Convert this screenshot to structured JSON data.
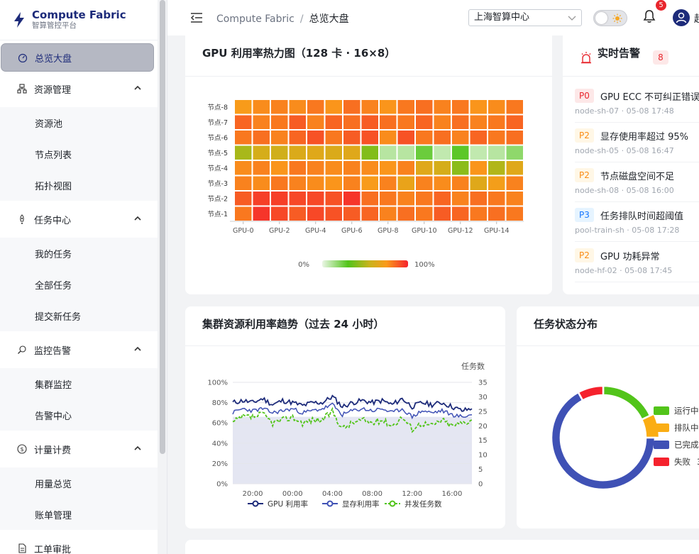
{
  "brand": {
    "name": "Compute Fabric",
    "subtitle": "智算管控平台"
  },
  "sidebar": {
    "active": "总览大盘",
    "groups": [
      {
        "label": "资源管理",
        "items": [
          "资源池",
          "节点列表",
          "拓扑视图"
        ]
      },
      {
        "label": "任务中心",
        "items": [
          "我的任务",
          "全部任务",
          "提交新任务"
        ]
      },
      {
        "label": "监控告警",
        "items": [
          "集群监控",
          "告警中心"
        ]
      },
      {
        "label": "计量计费",
        "items": [
          "用量总览",
          "账单管理"
        ]
      },
      {
        "label": "工单审批",
        "items": []
      }
    ]
  },
  "header": {
    "breadcrumb_root": "Compute Fabric",
    "breadcrumb_sep": "/",
    "breadcrumb_current": "总览大盘",
    "region": "上海智算中心",
    "notification_count": "5",
    "user_name": "赵"
  },
  "heatmap": {
    "title": "GPU 利用率热力图（128 卡 · 16×8）",
    "row_labels": [
      "节点-8",
      "节点-7",
      "节点-6",
      "节点-5",
      "节点-4",
      "节点-3",
      "节点-2",
      "节点-1"
    ],
    "col_tick_labels": [
      "GPU-0",
      "GPU-2",
      "GPU-4",
      "GPU-6",
      "GPU-8",
      "GPU-10",
      "GPU-12",
      "GPU-14"
    ],
    "legend_min": "0%",
    "legend_max": "100%",
    "values": [
      [
        74,
        78,
        80,
        78,
        82,
        76,
        84,
        80,
        76,
        82,
        84,
        80,
        82,
        76,
        78,
        82
      ],
      [
        86,
        80,
        82,
        88,
        80,
        86,
        84,
        88,
        84,
        82,
        86,
        80,
        84,
        80,
        82,
        86
      ],
      [
        82,
        84,
        80,
        86,
        90,
        82,
        88,
        90,
        78,
        90,
        82,
        84,
        80,
        86,
        82,
        84
      ],
      [
        48,
        60,
        58,
        62,
        64,
        62,
        64,
        40,
        10,
        10,
        25,
        8,
        28,
        8,
        10,
        18
      ],
      [
        78,
        80,
        76,
        82,
        80,
        78,
        80,
        78,
        76,
        80,
        64,
        60,
        42,
        76,
        50,
        64
      ],
      [
        80,
        78,
        82,
        80,
        78,
        76,
        80,
        74,
        80,
        68,
        80,
        78,
        80,
        64,
        72,
        80
      ],
      [
        88,
        94,
        94,
        92,
        92,
        90,
        96,
        84,
        82,
        80,
        82,
        86,
        80,
        84,
        82,
        80
      ],
      [
        82,
        96,
        92,
        88,
        92,
        90,
        88,
        86,
        80,
        84,
        82,
        88,
        86,
        82,
        84,
        82
      ]
    ]
  },
  "alarms": {
    "title": "实时告警",
    "count": "8",
    "items": [
      {
        "level": "P0",
        "text": "GPU ECC 不可纠正错误",
        "meta": "node-sh-07 · 05-08 17:48"
      },
      {
        "level": "P2",
        "text": "显存使用率超过 95%",
        "meta": "node-sh-05 · 05-08 16:47"
      },
      {
        "level": "P2",
        "text": "节点磁盘空间不足",
        "meta": "node-sh-08 · 05-08 16:00"
      },
      {
        "level": "P3",
        "text": "任务排队时间超阈值",
        "meta": "pool-train-sh · 05-08 17:28"
      },
      {
        "level": "P2",
        "text": "GPU 功耗异常",
        "meta": "node-hf-02 · 05-08 17:45"
      }
    ]
  },
  "trend": {
    "title": "集群资源利用率趋势（过去 24 小时）",
    "y_right_label": "任务数",
    "y_left_ticks": [
      "0%",
      "20%",
      "40%",
      "60%",
      "80%",
      "100%"
    ],
    "y_right_ticks": [
      "0",
      "5",
      "10",
      "15",
      "20",
      "25",
      "30",
      "35"
    ],
    "x_ticks": [
      "20:00",
      "00:00",
      "04:00",
      "08:00",
      "12:00",
      "16:00"
    ],
    "legend": [
      "GPU 利用率",
      "显存利用率",
      "并发任务数"
    ]
  },
  "status": {
    "title": "任务状态分布",
    "legend": [
      "运行中",
      "排队中",
      "已完成",
      "失败"
    ],
    "legend_suffix": [
      "",
      "",
      "",
      "3"
    ]
  },
  "colors": {
    "brand": "#1d2b7a",
    "gpu_line": "#1d2b7a",
    "mem_line": "#3f51b5",
    "task_line": "#52c41a",
    "running": "#52c41a",
    "queued": "#faad14",
    "completed": "#3f51b5",
    "failed": "#f5222d"
  },
  "chart_data": [
    {
      "type": "heatmap",
      "title": "GPU 利用率热力图（128 卡 · 16×8）",
      "rows": [
        "节点-8",
        "节点-7",
        "节点-6",
        "节点-5",
        "节点-4",
        "节点-3",
        "节点-2",
        "节点-1"
      ],
      "columns": [
        "GPU-0",
        "GPU-1",
        "GPU-2",
        "GPU-3",
        "GPU-4",
        "GPU-5",
        "GPU-6",
        "GPU-7",
        "GPU-8",
        "GPU-9",
        "GPU-10",
        "GPU-11",
        "GPU-12",
        "GPU-13",
        "GPU-14",
        "GPU-15"
      ],
      "range": [
        0,
        100
      ]
    },
    {
      "type": "line",
      "title": "集群资源利用率趋势（过去 24 小时）",
      "x": [
        "18:00",
        "19:00",
        "20:00",
        "21:00",
        "22:00",
        "23:00",
        "00:00",
        "01:00",
        "02:00",
        "03:00",
        "04:00",
        "05:00",
        "06:00",
        "07:00",
        "08:00",
        "09:00",
        "10:00",
        "11:00",
        "12:00",
        "13:00",
        "14:00",
        "15:00",
        "16:00",
        "17:00",
        "18:00"
      ],
      "series": [
        {
          "name": "GPU 利用率",
          "axis": "left",
          "values": [
            80,
            82,
            80,
            84,
            78,
            82,
            80,
            77,
            80,
            80,
            86,
            76,
            80,
            82,
            80,
            82,
            78,
            84,
            76,
            80,
            78,
            80,
            76,
            72,
            74
          ]
        },
        {
          "name": "显存利用率",
          "axis": "left",
          "values": [
            70,
            74,
            72,
            74,
            70,
            72,
            74,
            70,
            72,
            74,
            78,
            68,
            72,
            74,
            72,
            74,
            70,
            74,
            66,
            72,
            70,
            72,
            68,
            66,
            68
          ]
        },
        {
          "name": "并发任务数",
          "axis": "right",
          "values": [
            21,
            23,
            23,
            24,
            21,
            22,
            23,
            21,
            22,
            22,
            25,
            19,
            21,
            22,
            21,
            22,
            20,
            23,
            19,
            21,
            20,
            22,
            20,
            21,
            22
          ]
        }
      ],
      "ylim_left": [
        0,
        100
      ],
      "ylim_right": [
        0,
        35
      ],
      "ylabel_right": "任务数"
    },
    {
      "type": "pie",
      "title": "任务状态分布",
      "categories": [
        "运行中",
        "排队中",
        "已完成",
        "失败"
      ],
      "values": [
        18,
        7,
        67,
        8
      ]
    }
  ]
}
